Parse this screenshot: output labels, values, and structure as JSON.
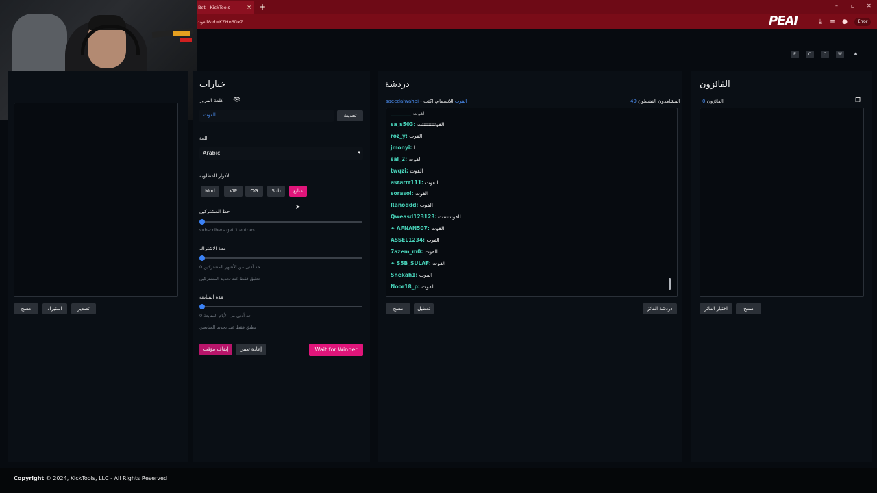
{
  "browser": {
    "tab_title": "Bot - KickTools",
    "tab_close": "×",
    "new_tab": "+",
    "url": "الفوت&id=KZHo6DxZ",
    "logo": "PEAI",
    "error_label": "Error",
    "window_controls": [
      "–",
      "▫",
      "✕"
    ]
  },
  "header_icons": [
    "E",
    "O",
    "C",
    "W",
    "✱"
  ],
  "options": {
    "title": "خيارات",
    "password_label": "كلمة المرور",
    "keyword_value": "الفوت",
    "update_button": "تحديث",
    "language_label": "اللغة",
    "language_value": "Arabic",
    "roles_label": "الأدوار المطلوبة",
    "roles": [
      "Mod",
      "VIP",
      "OG",
      "Sub",
      "متابع"
    ],
    "subscriber_luck_label": "حظ المشتركين",
    "subscriber_luck_hint": "subscribers get 1 entries",
    "sub_duration_label": "مدة الاشتراك",
    "sub_duration_value": "0",
    "sub_duration_hint1": "حد أدنى من الأشهر المشتركين",
    "sub_duration_hint2": "تطبق فقط عند تحديد المشتركين",
    "follow_duration_label": "مدة المتابعة",
    "follow_duration_value": "0",
    "follow_duration_hint1": "حد أدنى من الأيام المتابعة",
    "follow_duration_hint2": "تطبق فقط عند تحديد المتابعين",
    "pause_button": "إيقاف مؤقت",
    "reset_button": "إعادة تعيين",
    "wait_button": "Wait for Winner"
  },
  "left_panel": {
    "clear_button": "مسح",
    "import_button": "استيراد",
    "export_button": "تصدير"
  },
  "chat": {
    "title": "دردشة",
    "streamer": "saeedalwahbi",
    "join_prefix": "للانضمام، اكتب",
    "join_keyword": "الفوت",
    "viewers_label": "المشاهدون النشطون",
    "viewers_count": "49",
    "partial_top": "الفوت",
    "messages": [
      {
        "user": "sa_s503:",
        "text": "الفوتتتتتتتتتت"
      },
      {
        "user": "roz_y:",
        "text": "الفوت"
      },
      {
        "user": "jmonyi:",
        "text": "ا"
      },
      {
        "user": "sal_2:",
        "text": "الفوت"
      },
      {
        "user": "twqzi:",
        "text": "الفوت"
      },
      {
        "user": "asrarrr111:",
        "text": "الفوت"
      },
      {
        "user": "sorasol:",
        "text": "الفوت"
      },
      {
        "user": "Ranoddd:",
        "text": "الفوت"
      },
      {
        "user": "Qweasd123123:",
        "text": "الفوتتتتتتت"
      },
      {
        "user": "✦ AFNAN507:",
        "text": "الفوت"
      },
      {
        "user": "ASSEL1234:",
        "text": "الفوت"
      },
      {
        "user": "7azem_m0:",
        "text": "الفوت"
      },
      {
        "user": "✦ S5B_SULAF:",
        "text": "الفوت"
      },
      {
        "user": "Shekah1:",
        "text": "الفوت"
      },
      {
        "user": "Noor18_p:",
        "text": "الفوت"
      }
    ],
    "clear_button": "مسح",
    "disable_button": "تعطيل",
    "winner_chat_button": "دردشة الفائز"
  },
  "winners": {
    "title": "الفائزون",
    "count_label": "الفائزون",
    "count": "0",
    "pick_button": "اختيار الفائز",
    "clear_button": "مسح"
  },
  "footer": {
    "copyright_label": "Copyright",
    "copyright_text": "© 2024, KickTools, LLC - All Rights Reserved"
  }
}
